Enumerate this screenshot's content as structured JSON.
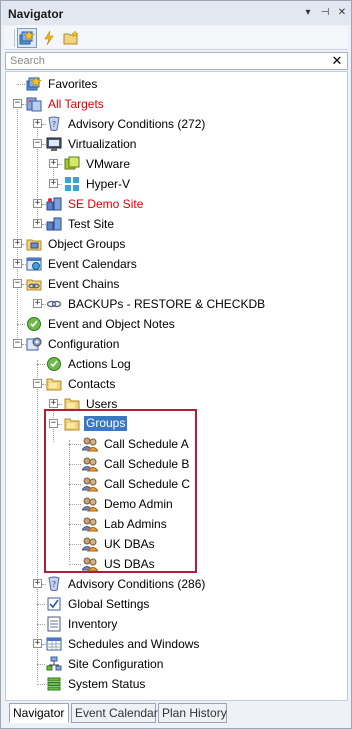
{
  "window": {
    "title": "Navigator"
  },
  "titlebar_buttons": {
    "dropdown": "▾",
    "pin": "⊣",
    "close": "✕"
  },
  "search": {
    "placeholder": "Search",
    "clear": "✕"
  },
  "tree": {
    "favorites": "Favorites",
    "all_targets": "All Targets",
    "advisory_conditions_1": "Advisory Conditions (272)",
    "virtualization": "Virtualization",
    "vmware": "VMware",
    "hyperv": "Hyper-V",
    "se_demo_site": "SE Demo Site",
    "test_site": "Test Site",
    "object_groups": "Object Groups",
    "event_calendars": "Event Calendars",
    "event_chains": "Event Chains",
    "backups": "BACKUPs - RESTORE & CHECKDB",
    "event_notes": "Event and Object Notes",
    "configuration": "Configuration",
    "actions_log": "Actions Log",
    "contacts": "Contacts",
    "users": "Users",
    "groups": "Groups",
    "call_schedule_a": "Call Schedule A",
    "call_schedule_b": "Call Schedule B",
    "call_schedule_c": "Call Schedule C",
    "demo_admin": "Demo Admin",
    "lab_admins": "Lab Admins",
    "uk_dbas": "UK DBAs",
    "us_dbas": "US DBAs",
    "advisory_conditions_2": "Advisory Conditions (286)",
    "global_settings": "Global Settings",
    "inventory": "Inventory",
    "schedules_windows": "Schedules and Windows",
    "site_configuration": "Site Configuration",
    "system_status": "System Status"
  },
  "tabs": {
    "navigator": "Navigator",
    "event_calendar": "Event Calendar",
    "plan_history": "Plan History"
  },
  "colors": {
    "red_text": "#e00000",
    "selection": "#3a78c4",
    "highlight_box": "#b01e3c"
  }
}
